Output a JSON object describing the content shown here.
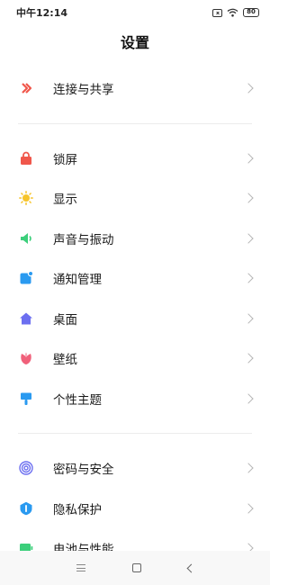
{
  "status": {
    "time": "中午12:14",
    "battery": "80"
  },
  "title": "设置",
  "groups": [
    {
      "items": [
        {
          "label": "连接与共享",
          "icon": "share-connection-icon",
          "color": "#f0574b"
        }
      ]
    },
    {
      "items": [
        {
          "label": "锁屏",
          "icon": "lock-screen-icon",
          "color": "#f0574b"
        },
        {
          "label": "显示",
          "icon": "sun-icon",
          "color": "#f6c42b"
        },
        {
          "label": "声音与振动",
          "icon": "speaker-icon",
          "color": "#3ccf7b"
        },
        {
          "label": "通知管理",
          "icon": "notification-icon",
          "color": "#2a9af0"
        },
        {
          "label": "桌面",
          "icon": "home-icon",
          "color": "#6c6ff0"
        },
        {
          "label": "壁纸",
          "icon": "wallpaper-icon",
          "color": "#f0607a"
        },
        {
          "label": "个性主题",
          "icon": "theme-brush-icon",
          "color": "#2a9af0"
        }
      ]
    },
    {
      "items": [
        {
          "label": "密码与安全",
          "icon": "fingerprint-icon",
          "color": "#6c6ff0"
        },
        {
          "label": "隐私保护",
          "icon": "privacy-shield-icon",
          "color": "#2a9af0"
        },
        {
          "label": "电池与性能",
          "icon": "battery-icon",
          "color": "#3ccf7b"
        }
      ]
    }
  ]
}
